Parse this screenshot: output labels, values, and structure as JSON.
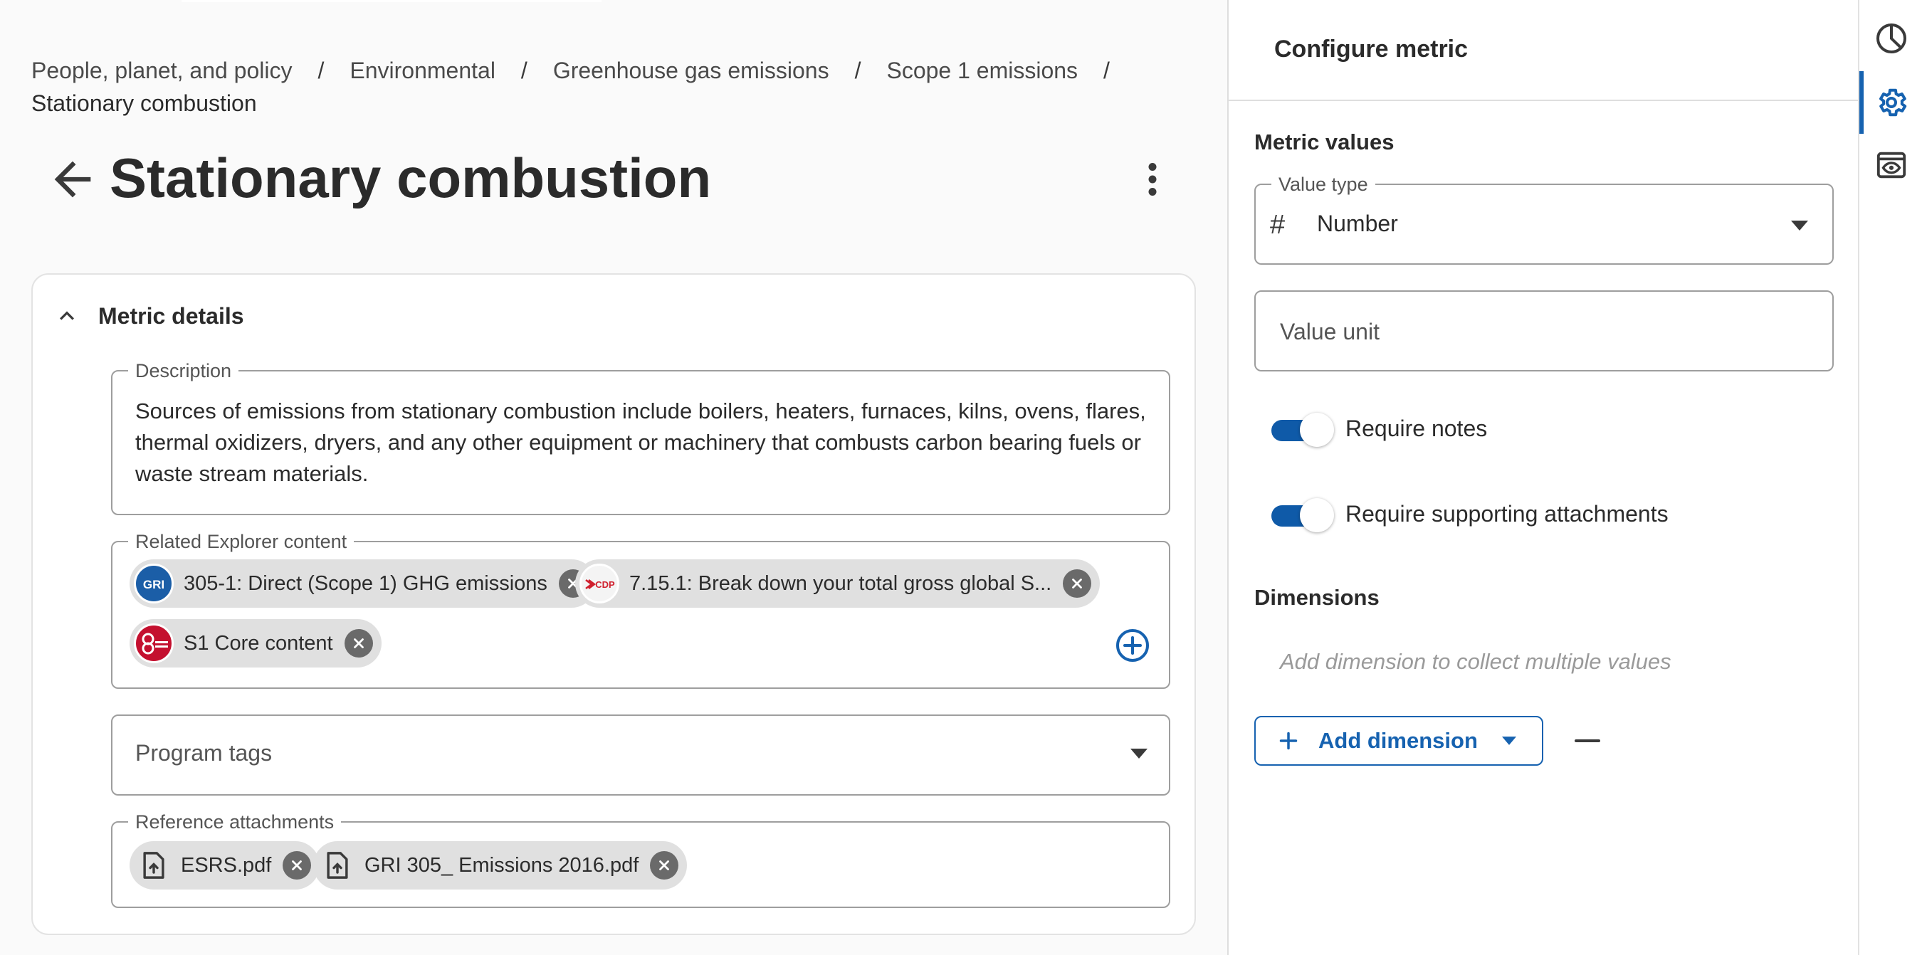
{
  "breadcrumb": {
    "items": [
      "People, planet, and policy",
      "Environmental",
      "Greenhouse gas emissions",
      "Scope 1 emissions"
    ],
    "separator": "/",
    "current": "Stationary combustion"
  },
  "page": {
    "title": "Stationary combustion"
  },
  "metric_details": {
    "header": "Metric details",
    "description": {
      "label": "Description",
      "value": "Sources of emissions from stationary combustion include boilers, heaters, furnaces, kilns, ovens, flares, thermal oxidizers, dryers, and any other equipment or machinery that combusts carbon bearing fuels or waste stream materials."
    },
    "related_content": {
      "label": "Related Explorer content",
      "chips": [
        {
          "logo_text": "GRI",
          "label": "305-1: Direct (Scope 1) GHG emissions"
        },
        {
          "logo_text": "CDP",
          "label": "7.15.1: Break down your total gross global S..."
        },
        {
          "logo_text": "S1",
          "label": "S1 Core content"
        }
      ]
    },
    "program_tags": {
      "placeholder": "Program tags"
    },
    "reference_attachments": {
      "label": "Reference attachments",
      "files": [
        "ESRS.pdf",
        "GRI 305_ Emissions 2016.pdf"
      ]
    }
  },
  "configure_panel": {
    "title": "Configure metric",
    "metric_values_label": "Metric values",
    "value_type": {
      "label": "Value type",
      "symbol": "#",
      "value": "Number"
    },
    "value_unit": {
      "placeholder": "Value unit"
    },
    "toggles": [
      {
        "label": "Require notes",
        "on": true
      },
      {
        "label": "Require supporting attachments",
        "on": true
      }
    ],
    "dimensions": {
      "label": "Dimensions",
      "placeholder": "Add dimension to collect multiple values",
      "add_button": "Add dimension"
    }
  },
  "rail": {
    "icons": [
      "pie-chart-icon",
      "gear-icon",
      "preview-eye-icon"
    ],
    "active": "gear-icon"
  },
  "colors": {
    "accent": "#1662b0",
    "toggle_on": "#0f5aa8",
    "chip_bg": "#e0e0e0",
    "gri_logo": "#1b5ea7",
    "cdp_logo": "#d0202e",
    "s1_logo": "#c4102f"
  }
}
